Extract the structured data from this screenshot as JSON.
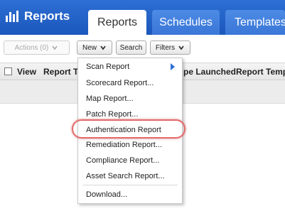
{
  "header": {
    "brand": "Reports",
    "tabs": [
      {
        "label": "Reports",
        "active": true
      },
      {
        "label": "Schedules",
        "active": false
      },
      {
        "label": "Templates",
        "active": false
      }
    ]
  },
  "toolbar": {
    "actions_label": "Actions (0)",
    "new_label": "New",
    "search_label": "Search",
    "filters_label": "Filters"
  },
  "table": {
    "headers": [
      "View",
      "Report T",
      "pe Launched",
      "Report Temp"
    ]
  },
  "new_menu": {
    "items": [
      {
        "label": "Scan Report",
        "submenu": true
      },
      {
        "label": "Scorecard Report..."
      },
      {
        "label": "Map Report..."
      },
      {
        "label": "Patch Report..."
      },
      {
        "label": "Authentication Report",
        "highlighted": true
      },
      {
        "label": "Remediation Report..."
      },
      {
        "label": "Compliance Report..."
      },
      {
        "label": "Asset Search Report..."
      },
      {
        "label": "Download..."
      }
    ]
  },
  "colors": {
    "header_blue": "#1b57bc",
    "highlight_ring": "#e26a6a"
  }
}
